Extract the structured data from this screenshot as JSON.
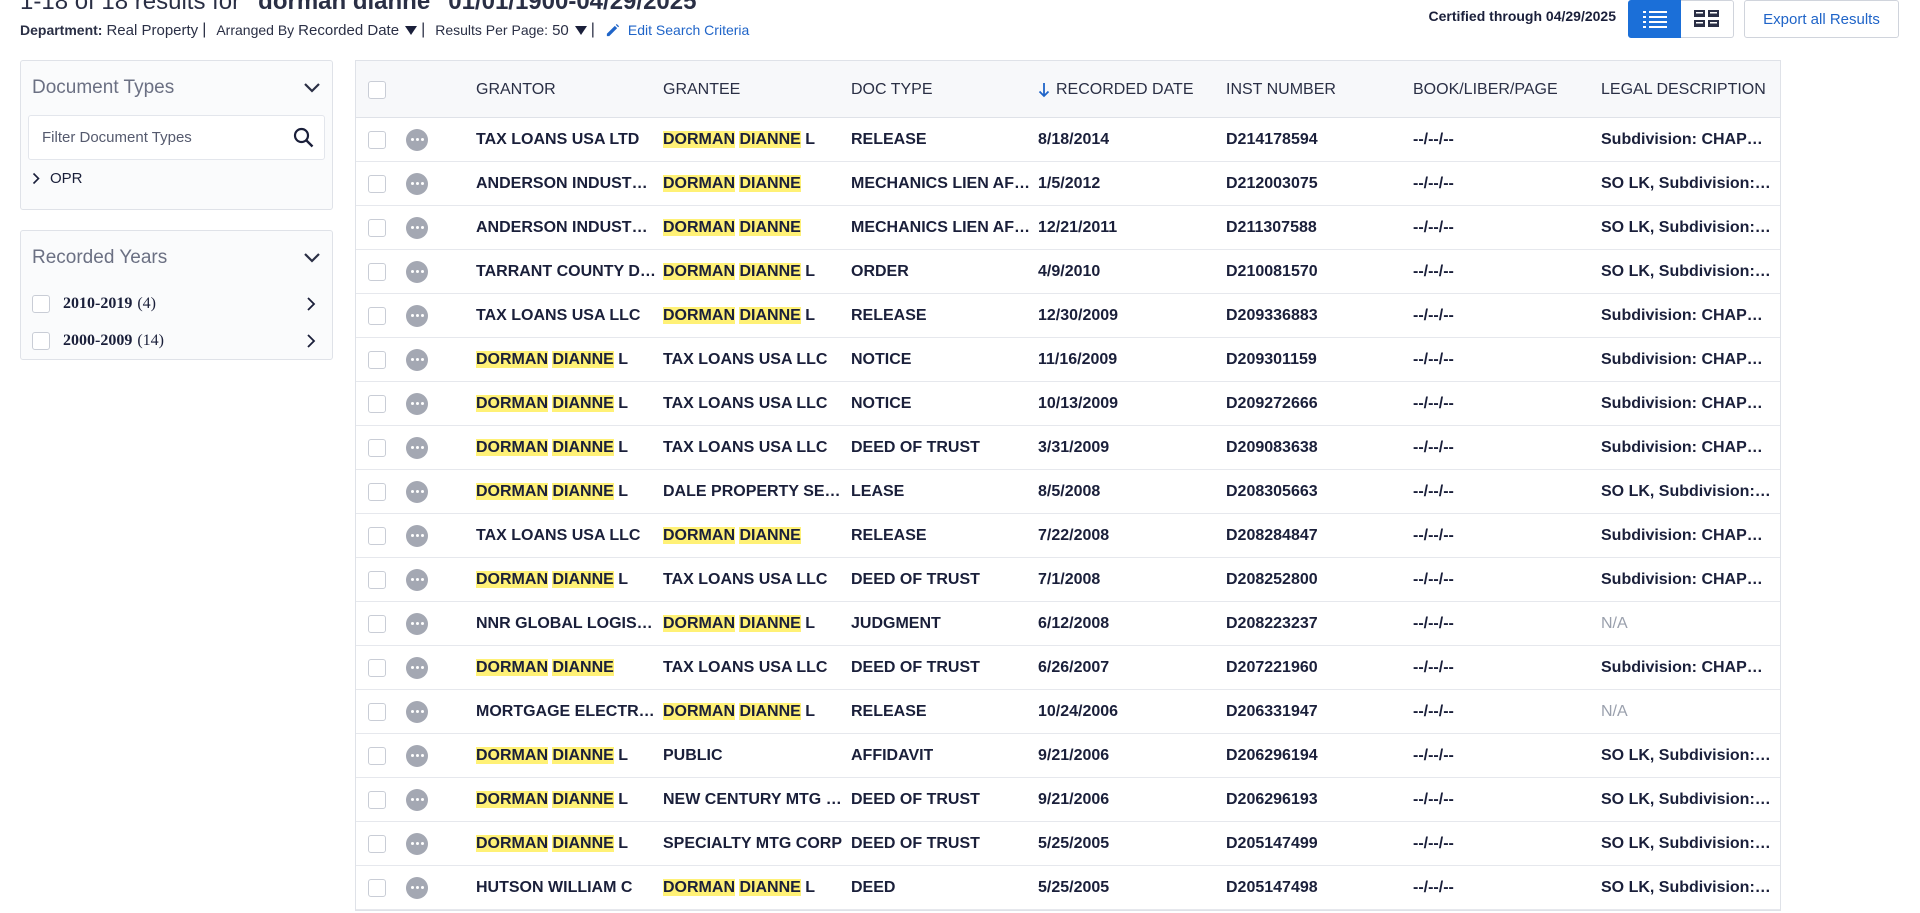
{
  "header": {
    "results_prefix": "1-18 of 18 results for ",
    "results_query": "\"dorman dianne\" 01/01/1900-04/29/2025",
    "department_label": "Department:",
    "department_value": "Real Property",
    "arranged_label": "Arranged By",
    "arranged_value": "Recorded Date",
    "per_page_label": "Results Per Page:",
    "per_page_value": "50",
    "edit_label": "Edit Search Criteria",
    "certified": "Certified through 04/29/2025",
    "export_label": "Export all Results",
    "icons": {
      "list_view": "list-view-icon",
      "grid_view": "grid-view-icon",
      "edit": "pencil-icon"
    },
    "accent": "#1b6fd8"
  },
  "sidebar": {
    "doc_types": {
      "title": "Document Types",
      "filter_placeholder": "Filter Document Types",
      "items": [
        {
          "label": "OPR"
        }
      ]
    },
    "years": {
      "title": "Recorded Years",
      "items": [
        {
          "label": "2010-2019",
          "count": "(4)"
        },
        {
          "label": "2000-2009",
          "count": "(14)"
        }
      ]
    }
  },
  "table": {
    "columns": {
      "grantor": "GRANTOR",
      "grantee": "GRANTEE",
      "doc_type": "DOC TYPE",
      "recorded_date": "RECORDED DATE",
      "inst_number": "INST NUMBER",
      "book": "BOOK/LIBER/PAGE",
      "legal": "LEGAL DESCRIPTION"
    },
    "highlight_color": "#fff176",
    "rows": [
      {
        "grantor": "TAX LOANS USA LTD",
        "grantee": "DORMAN DIANNE L",
        "doc_type": "RELEASE",
        "recorded_date": "8/18/2014",
        "inst_number": "D214178594",
        "book": "--/--/--",
        "legal": "Subdivision: CHAPEL HILL"
      },
      {
        "grantor": "ANDERSON INDUSTRIES",
        "grantee": "DORMAN DIANNE",
        "doc_type": "MECHANICS LIEN AFFIDAVIT",
        "recorded_date": "1/5/2012",
        "inst_number": "D212003075",
        "book": "--/--/--",
        "legal": "SO LK, Subdivision: CHAPEL"
      },
      {
        "grantor": "ANDERSON INDUSTRIES",
        "grantee": "DORMAN DIANNE",
        "doc_type": "MECHANICS LIEN AFFIDAVIT",
        "recorded_date": "12/21/2011",
        "inst_number": "D211307588",
        "book": "--/--/--",
        "legal": "SO LK, Subdivision: CHAPEL"
      },
      {
        "grantor": "TARRANT COUNTY DISTRICT",
        "grantee": "DORMAN DIANNE L",
        "doc_type": "ORDER",
        "recorded_date": "4/9/2010",
        "inst_number": "D210081570",
        "book": "--/--/--",
        "legal": "SO LK, Subdivision: CHAPEL"
      },
      {
        "grantor": "TAX LOANS USA LLC",
        "grantee": "DORMAN DIANNE L",
        "doc_type": "RELEASE",
        "recorded_date": "12/30/2009",
        "inst_number": "D209336883",
        "book": "--/--/--",
        "legal": "Subdivision: CHAPEL HILL"
      },
      {
        "grantor": "DORMAN DIANNE L",
        "grantee": "TAX LOANS USA LLC",
        "doc_type": "NOTICE",
        "recorded_date": "11/16/2009",
        "inst_number": "D209301159",
        "book": "--/--/--",
        "legal": "Subdivision: CHAPEL HILL"
      },
      {
        "grantor": "DORMAN DIANNE L",
        "grantee": "TAX LOANS USA LLC",
        "doc_type": "NOTICE",
        "recorded_date": "10/13/2009",
        "inst_number": "D209272666",
        "book": "--/--/--",
        "legal": "Subdivision: CHAPEL HILL"
      },
      {
        "grantor": "DORMAN DIANNE L",
        "grantee": "TAX LOANS USA LLC",
        "doc_type": "DEED OF TRUST",
        "recorded_date": "3/31/2009",
        "inst_number": "D209083638",
        "book": "--/--/--",
        "legal": "Subdivision: CHAPEL HILL"
      },
      {
        "grantor": "DORMAN DIANNE L",
        "grantee": "DALE PROPERTY SERVICES",
        "doc_type": "LEASE",
        "recorded_date": "8/5/2008",
        "inst_number": "D208305663",
        "book": "--/--/--",
        "legal": "SO LK, Subdivision: CHAPEL"
      },
      {
        "grantor": "TAX LOANS USA LLC",
        "grantee": "DORMAN DIANNE",
        "doc_type": "RELEASE",
        "recorded_date": "7/22/2008",
        "inst_number": "D208284847",
        "book": "--/--/--",
        "legal": "Subdivision: CHAPEL HILL"
      },
      {
        "grantor": "DORMAN DIANNE L",
        "grantee": "TAX LOANS USA LLC",
        "doc_type": "DEED OF TRUST",
        "recorded_date": "7/1/2008",
        "inst_number": "D208252800",
        "book": "--/--/--",
        "legal": "Subdivision: CHAPEL HILL"
      },
      {
        "grantor": "NNR GLOBAL LOGISTICS",
        "grantee": "DORMAN DIANNE L",
        "doc_type": "JUDGMENT",
        "recorded_date": "6/12/2008",
        "inst_number": "D208223237",
        "book": "--/--/--",
        "legal": "N/A"
      },
      {
        "grantor": "DORMAN DIANNE",
        "grantee": "TAX LOANS USA LLC",
        "doc_type": "DEED OF TRUST",
        "recorded_date": "6/26/2007",
        "inst_number": "D207221960",
        "book": "--/--/--",
        "legal": "Subdivision: CHAPEL HILL"
      },
      {
        "grantor": "MORTGAGE ELECTRONIC",
        "grantee": "DORMAN DIANNE L",
        "doc_type": "RELEASE",
        "recorded_date": "10/24/2006",
        "inst_number": "D206331947",
        "book": "--/--/--",
        "legal": "N/A"
      },
      {
        "grantor": "DORMAN DIANNE L",
        "grantee": "PUBLIC",
        "doc_type": "AFFIDAVIT",
        "recorded_date": "9/21/2006",
        "inst_number": "D206296194",
        "book": "--/--/--",
        "legal": "SO LK, Subdivision: CHAPEL"
      },
      {
        "grantor": "DORMAN DIANNE L",
        "grantee": "NEW CENTURY MTG CORP",
        "doc_type": "DEED OF TRUST",
        "recorded_date": "9/21/2006",
        "inst_number": "D206296193",
        "book": "--/--/--",
        "legal": "SO LK, Subdivision: CHAPEL"
      },
      {
        "grantor": "DORMAN DIANNE L",
        "grantee": "SPECIALTY MTG CORP",
        "doc_type": "DEED OF TRUST",
        "recorded_date": "5/25/2005",
        "inst_number": "D205147499",
        "book": "--/--/--",
        "legal": "SO LK, Subdivision: CHAPEL"
      },
      {
        "grantor": "HUTSON WILLIAM C",
        "grantee": "DORMAN DIANNE L",
        "doc_type": "DEED",
        "recorded_date": "5/25/2005",
        "inst_number": "D205147498",
        "book": "--/--/--",
        "legal": "SO LK, Subdivision: CHAPEL"
      }
    ]
  }
}
